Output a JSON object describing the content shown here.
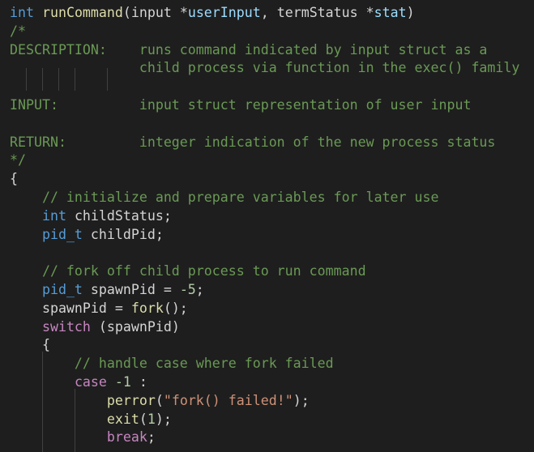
{
  "editor": {
    "colors": {
      "background": "#1e1e1e",
      "keyword": "#569cd6",
      "type": "#4ec9b0",
      "function": "#dcdcaa",
      "variable": "#9cdcfe",
      "comment": "#6a9955",
      "string": "#ce9178",
      "number": "#b5cea8",
      "control": "#c586c0",
      "plain": "#d4d4d4"
    },
    "lines": [
      [
        {
          "t": "int",
          "c": "kw"
        },
        {
          "t": " ",
          "c": "pl"
        },
        {
          "t": "runCommand",
          "c": "fn"
        },
        {
          "t": "(input *",
          "c": "pl"
        },
        {
          "t": "userInput",
          "c": "var"
        },
        {
          "t": ", termStatus *",
          "c": "pl"
        },
        {
          "t": "stat",
          "c": "var"
        },
        {
          "t": ")",
          "c": "pl"
        }
      ],
      [
        {
          "t": "/*",
          "c": "cmt"
        }
      ],
      [
        {
          "t": "DESCRIPTION:    runs command indicated by input struct as a",
          "c": "cmt"
        }
      ],
      [
        {
          "t": "                child process via function in the exec() family",
          "c": "cmt"
        }
      ],
      [],
      [
        {
          "t": "INPUT:          input struct representation of user input",
          "c": "cmt"
        }
      ],
      [],
      [
        {
          "t": "RETURN:         integer indication of the new process status",
          "c": "cmt"
        }
      ],
      [
        {
          "t": "*/",
          "c": "cmt"
        }
      ],
      [
        {
          "t": "{",
          "c": "pl"
        }
      ],
      [
        {
          "t": "    // initialize and prepare variables for later use",
          "c": "cmt"
        }
      ],
      [
        {
          "t": "    ",
          "c": "pl"
        },
        {
          "t": "int",
          "c": "kw"
        },
        {
          "t": " childStatus;",
          "c": "pl"
        }
      ],
      [
        {
          "t": "    ",
          "c": "pl"
        },
        {
          "t": "pid_t",
          "c": "kw"
        },
        {
          "t": " childPid;",
          "c": "pl"
        }
      ],
      [],
      [
        {
          "t": "    // fork off child process to run command",
          "c": "cmt"
        }
      ],
      [
        {
          "t": "    ",
          "c": "pl"
        },
        {
          "t": "pid_t",
          "c": "kw"
        },
        {
          "t": " spawnPid = ",
          "c": "pl"
        },
        {
          "t": "-5",
          "c": "num"
        },
        {
          "t": ";",
          "c": "pl"
        }
      ],
      [
        {
          "t": "    spawnPid = ",
          "c": "pl"
        },
        {
          "t": "fork",
          "c": "fn"
        },
        {
          "t": "();",
          "c": "pl"
        }
      ],
      [
        {
          "t": "    ",
          "c": "pl"
        },
        {
          "t": "switch",
          "c": "ctl"
        },
        {
          "t": " (spawnPid)",
          "c": "pl"
        }
      ],
      [
        {
          "t": "    {",
          "c": "pl"
        }
      ],
      [
        {
          "t": "        // handle case where fork failed",
          "c": "cmt"
        }
      ],
      [
        {
          "t": "        ",
          "c": "pl"
        },
        {
          "t": "case",
          "c": "ctl"
        },
        {
          "t": " ",
          "c": "pl"
        },
        {
          "t": "-1",
          "c": "num"
        },
        {
          "t": " :",
          "c": "pl"
        }
      ],
      [
        {
          "t": "            ",
          "c": "pl"
        },
        {
          "t": "perror",
          "c": "fn"
        },
        {
          "t": "(",
          "c": "pl"
        },
        {
          "t": "\"fork() failed!\"",
          "c": "str"
        },
        {
          "t": ");",
          "c": "pl"
        }
      ],
      [
        {
          "t": "            ",
          "c": "pl"
        },
        {
          "t": "exit",
          "c": "fn"
        },
        {
          "t": "(",
          "c": "pl"
        },
        {
          "t": "1",
          "c": "num"
        },
        {
          "t": ");",
          "c": "pl"
        }
      ],
      [
        {
          "t": "            ",
          "c": "pl"
        },
        {
          "t": "break",
          "c": "ctl"
        },
        {
          "t": ";",
          "c": "pl"
        }
      ]
    ]
  }
}
